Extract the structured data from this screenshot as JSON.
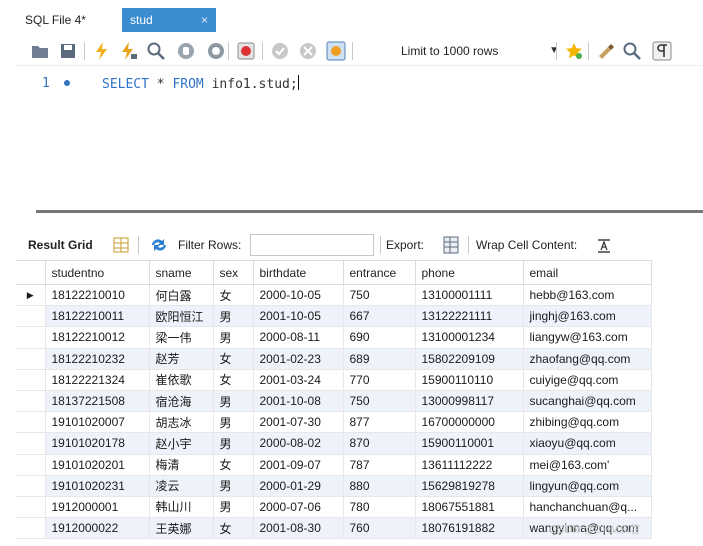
{
  "tabs": [
    {
      "label": "SQL File 4*",
      "active": false
    },
    {
      "label": "stud",
      "active": true,
      "close": "×"
    }
  ],
  "toolbar": {
    "limit_label": "Limit to 1000 rows",
    "icons": [
      "open-folder-icon",
      "save-icon",
      "execute-lightning-icon",
      "execute-current-lightning-icon",
      "explain-magnifier-icon",
      "stop-hand-icon",
      "toggle-error-icon",
      "commit-check-icon",
      "rollback-cancel-icon",
      "autocommit-icon",
      "add-favorite-star-icon",
      "beautify-brush-icon",
      "find-icon",
      "invisible-chars-icon"
    ]
  },
  "editor": {
    "line_number": "1",
    "tokens": {
      "select": "SELECT",
      "star": " * ",
      "from": "FROM",
      "table": " info1.stud;"
    }
  },
  "result_bar": {
    "result_grid": "Result Grid",
    "filter_rows": "Filter Rows:",
    "export": "Export:",
    "wrap": "Wrap Cell Content:"
  },
  "grid": {
    "columns": [
      "studentno",
      "sname",
      "sex",
      "birthdate",
      "entrance",
      "phone",
      "email"
    ],
    "rows": [
      [
        "18122210010",
        "何白露",
        "女",
        "2000-10-05",
        "750",
        "13100001111",
        "hebb@163.com"
      ],
      [
        "18122210011",
        "欧阳恒江",
        "男",
        "2001-10-05",
        "667",
        "13122221111",
        "jinghj@163.com"
      ],
      [
        "18122210012",
        "梁一伟",
        "男",
        "2000-08-11",
        "690",
        "13100001234",
        "liangyw@163.com"
      ],
      [
        "18122210232",
        "赵芳",
        "女",
        "2001-02-23",
        "689",
        "15802209109",
        "zhaofang@qq.com"
      ],
      [
        "18122221324",
        "崔依歌",
        "女",
        "2001-03-24",
        "770",
        "15900110110",
        "cuiyige@qq.com"
      ],
      [
        "18137221508",
        "宿沧海",
        "男",
        "2001-10-08",
        "750",
        "13000998117",
        "sucanghai@qq.com"
      ],
      [
        "19101020007",
        "胡志冰",
        "男",
        "2001-07-30",
        "877",
        "16700000000",
        "zhibing@qq.com"
      ],
      [
        "19101020178",
        "赵小宇",
        "男",
        "2000-08-02",
        "870",
        "15900110001",
        "xiaoyu@qq.com"
      ],
      [
        "19101020201",
        "梅清",
        "女",
        "2001-09-07",
        "787",
        "13611112222",
        "mei@163.com'"
      ],
      [
        "19101020231",
        "凌云",
        "男",
        "2000-01-29",
        "880",
        "15629819278",
        "lingyun@qq.com"
      ],
      [
        "1912000001",
        "韩山川",
        "男",
        "2000-07-06",
        "780",
        "18067551881",
        "hanchanchuan@q..."
      ],
      [
        "1912000022",
        "王英娜",
        "女",
        "2001-08-30",
        "760",
        "18076191882",
        "wangyinna@qq.com"
      ]
    ]
  },
  "watermark": "CSDN @CHMSI甘",
  "colors": {
    "active_tab": "#3c8dcf",
    "keyword": "#2f73c7",
    "alt_row": "#eef3fb"
  }
}
